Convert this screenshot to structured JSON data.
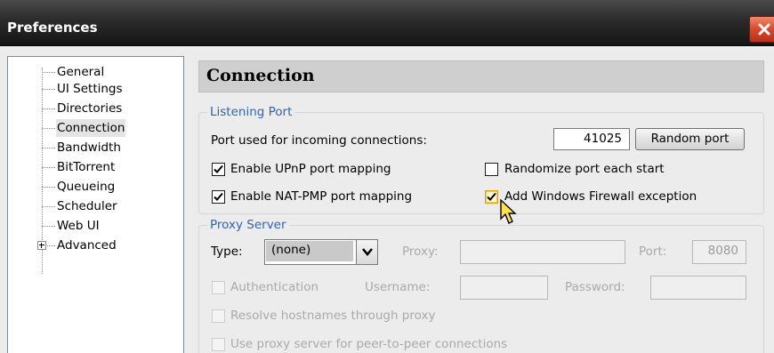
{
  "window": {
    "title": "Preferences",
    "close_icon": "close-icon"
  },
  "sidebar": {
    "items": [
      {
        "label": "General"
      },
      {
        "label": "UI Settings"
      },
      {
        "label": "Directories"
      },
      {
        "label": "Connection",
        "selected": true
      },
      {
        "label": "Bandwidth"
      },
      {
        "label": "BitTorrent"
      },
      {
        "label": "Queueing"
      },
      {
        "label": "Scheduler"
      },
      {
        "label": "Web UI"
      },
      {
        "label": "Advanced",
        "expandable": true
      }
    ]
  },
  "page": {
    "title": "Connection"
  },
  "listening_port": {
    "group_title": "Listening Port",
    "port_label": "Port used for incoming connections:",
    "port_value": "41025",
    "random_port_label": "Random port",
    "upnp_label": "Enable UPnP port mapping",
    "upnp_checked": true,
    "natpmp_label": "Enable NAT-PMP port mapping",
    "natpmp_checked": true,
    "randomize_label": "Randomize port each start",
    "randomize_checked": false,
    "firewall_label": "Add Windows Firewall exception",
    "firewall_checked": true
  },
  "proxy": {
    "group_title": "Proxy Server",
    "type_label": "Type:",
    "type_value": "(none)",
    "proxy_label": "Proxy:",
    "proxy_value": "",
    "port_label": "Port:",
    "port_value": "8080",
    "auth_label": "Authentication",
    "username_label": "Username:",
    "password_label": "Password:",
    "resolve_label": "Resolve hostnames through proxy",
    "p2p_label": "Use proxy server for peer-to-peer connections"
  }
}
